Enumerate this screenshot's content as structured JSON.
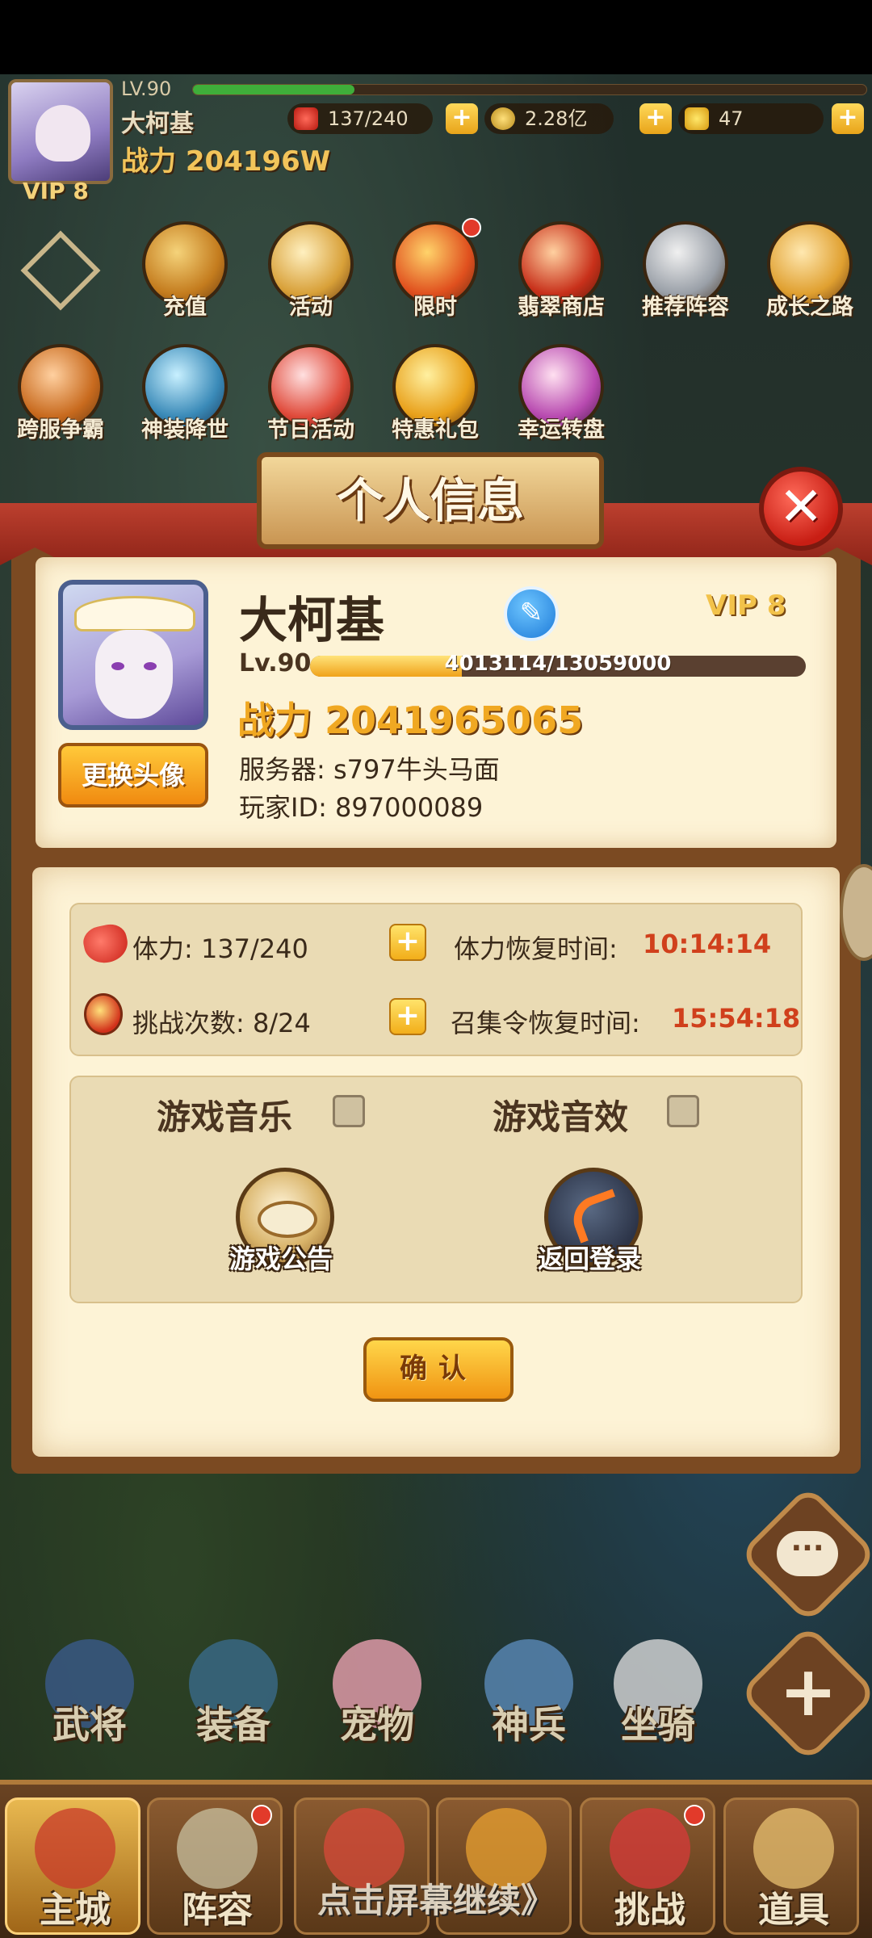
{
  "hud": {
    "level": "LV.90",
    "level_progress": 0.24,
    "name": "大柯基",
    "power": "战力 204196W",
    "vip": "VIP 8",
    "stamina": "137/240",
    "gold": "2.28亿",
    "ingots": "47",
    "plus": "+"
  },
  "activities_row1": [
    "充值",
    "活动",
    "限时",
    "翡翠商店",
    "推荐阵容",
    "成长之路"
  ],
  "activities_row2": [
    "跨服争霸",
    "神装降世",
    "节日活动",
    "特惠礼包",
    "幸运转盘"
  ],
  "dialog": {
    "title": "个人信息",
    "close": "✕",
    "player_name": "大柯基",
    "vip": "VIP 8",
    "level": "Lv.90",
    "exp": "4013114/13059000",
    "exp_progress": 0.307,
    "power": "战力 2041965065",
    "server": "服务器: s797牛头马面",
    "player_id": "玩家ID: 897000089",
    "change_avatar": "更换头像",
    "edit_icon": "✎",
    "stamina_label": "体力: 137/240",
    "stamina_recover_label": "体力恢复时间:",
    "stamina_recover_time": "10:14:14",
    "challenge_label": "挑战次数: 8/24",
    "summon_recover_label": "召集令恢复时间:",
    "summon_recover_time": "15:54:18",
    "plus": "+",
    "music_label": "游戏音乐",
    "sound_label": "游戏音效",
    "notice_label": "游戏公告",
    "back_login_label": "返回登录",
    "confirm": "确认"
  },
  "side": {
    "chat": "···",
    "add": "+"
  },
  "characters": [
    "武将",
    "装备",
    "宠物",
    "神兵",
    "坐骑"
  ],
  "nav": [
    "主城",
    "阵容",
    "",
    "",
    "挑战",
    "道具"
  ],
  "continue_hint": "点击屏幕继续》",
  "colors": {
    "accent_gold": "#f0a822",
    "timer_red": "#d0401c",
    "dialog_bg": "#fdf3d6"
  }
}
